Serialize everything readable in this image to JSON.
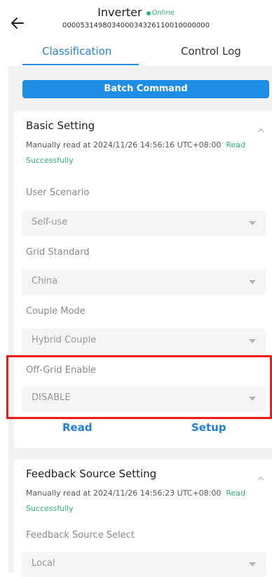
{
  "header": {
    "title": "Inverter",
    "status": "Online",
    "serial": "000053149803400034326110010000000"
  },
  "tabs": [
    "Classification",
    "Control Log"
  ],
  "batch_command_label": "Batch Command",
  "basic_setting": {
    "title": "Basic Setting",
    "read_info": "Manually read at 2024/11/26 14:56:16 UTC+08:00",
    "read_status": "Read Successfully",
    "fields": [
      {
        "label": "User Scenario",
        "value": "Self-use"
      },
      {
        "label": "Grid Standard",
        "value": "China"
      },
      {
        "label": "Couple Mode",
        "value": "Hybrid Couple"
      },
      {
        "label": "Off-Grid Enable",
        "value": "DISABLE"
      }
    ],
    "read_label": "Read",
    "setup_label": "Setup"
  },
  "feedback_setting": {
    "title": "Feedback Source Setting",
    "read_info": "Manually read at 2024/11/26 14:56:23 UTC+08:00",
    "read_status": "Read Successfully",
    "fields": [
      {
        "label": "Feedback Source Select",
        "value": "Local"
      }
    ]
  },
  "colors": {
    "accent": "#1f8de6",
    "success": "#2db37d",
    "highlight": "#f01a1a"
  }
}
